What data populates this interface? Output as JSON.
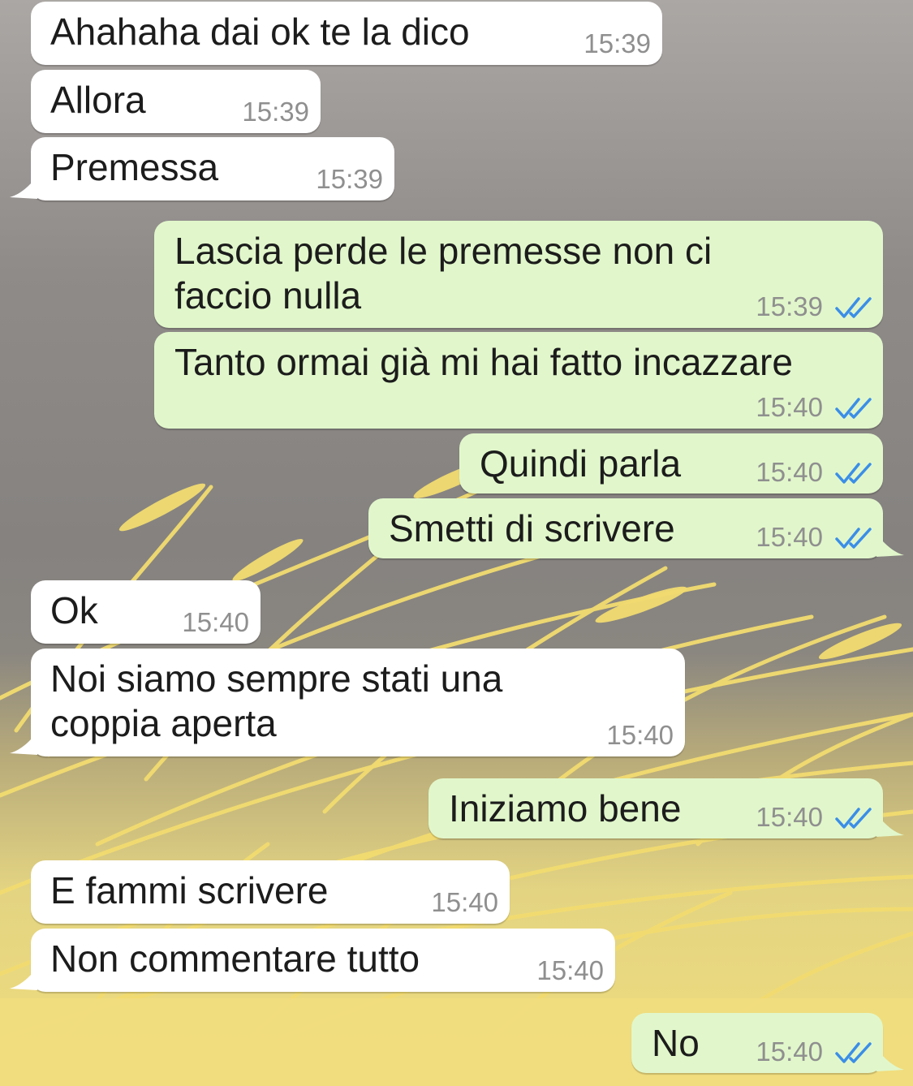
{
  "messages": [
    {
      "dir": "in",
      "text": "Ahahaha dai ok te la dico",
      "time": "15:39"
    },
    {
      "dir": "in",
      "text": "Allora",
      "time": "15:39"
    },
    {
      "dir": "in",
      "text": "Premessa",
      "time": "15:39"
    },
    {
      "dir": "out",
      "text": "Lascia perde le premesse non ci\nfaccio nulla",
      "time": "15:39",
      "status": "read-double-check"
    },
    {
      "dir": "out",
      "text": "Tanto ormai già mi hai fatto incazzare",
      "time": "15:40",
      "status": "read-double-check"
    },
    {
      "dir": "out",
      "text": "Quindi parla",
      "time": "15:40",
      "status": "read-double-check"
    },
    {
      "dir": "out",
      "text": "Smetti di scrivere",
      "time": "15:40",
      "status": "read-double-check"
    },
    {
      "dir": "in",
      "text": "Ok",
      "time": "15:40"
    },
    {
      "dir": "in",
      "text": "Noi siamo sempre stati una\ncoppia aperta",
      "time": "15:40"
    },
    {
      "dir": "out",
      "text": "Iniziamo bene",
      "time": "15:40",
      "status": "read-double-check"
    },
    {
      "dir": "in",
      "text": "E fammi scrivere",
      "time": "15:40"
    },
    {
      "dir": "in",
      "text": "Non commentare tutto",
      "time": "15:40"
    },
    {
      "dir": "out",
      "text": "No",
      "time": "15:40",
      "status": "read-double-check"
    }
  ],
  "colors": {
    "incoming_bubble": "#ffffff",
    "outgoing_bubble": "#e1f7cb",
    "read_tick": "#3b8ee8",
    "timestamp": "#8f8f8f",
    "wallpaper_grass": "#f3dc72"
  },
  "wallpaper": "wheat-grass-illustration"
}
